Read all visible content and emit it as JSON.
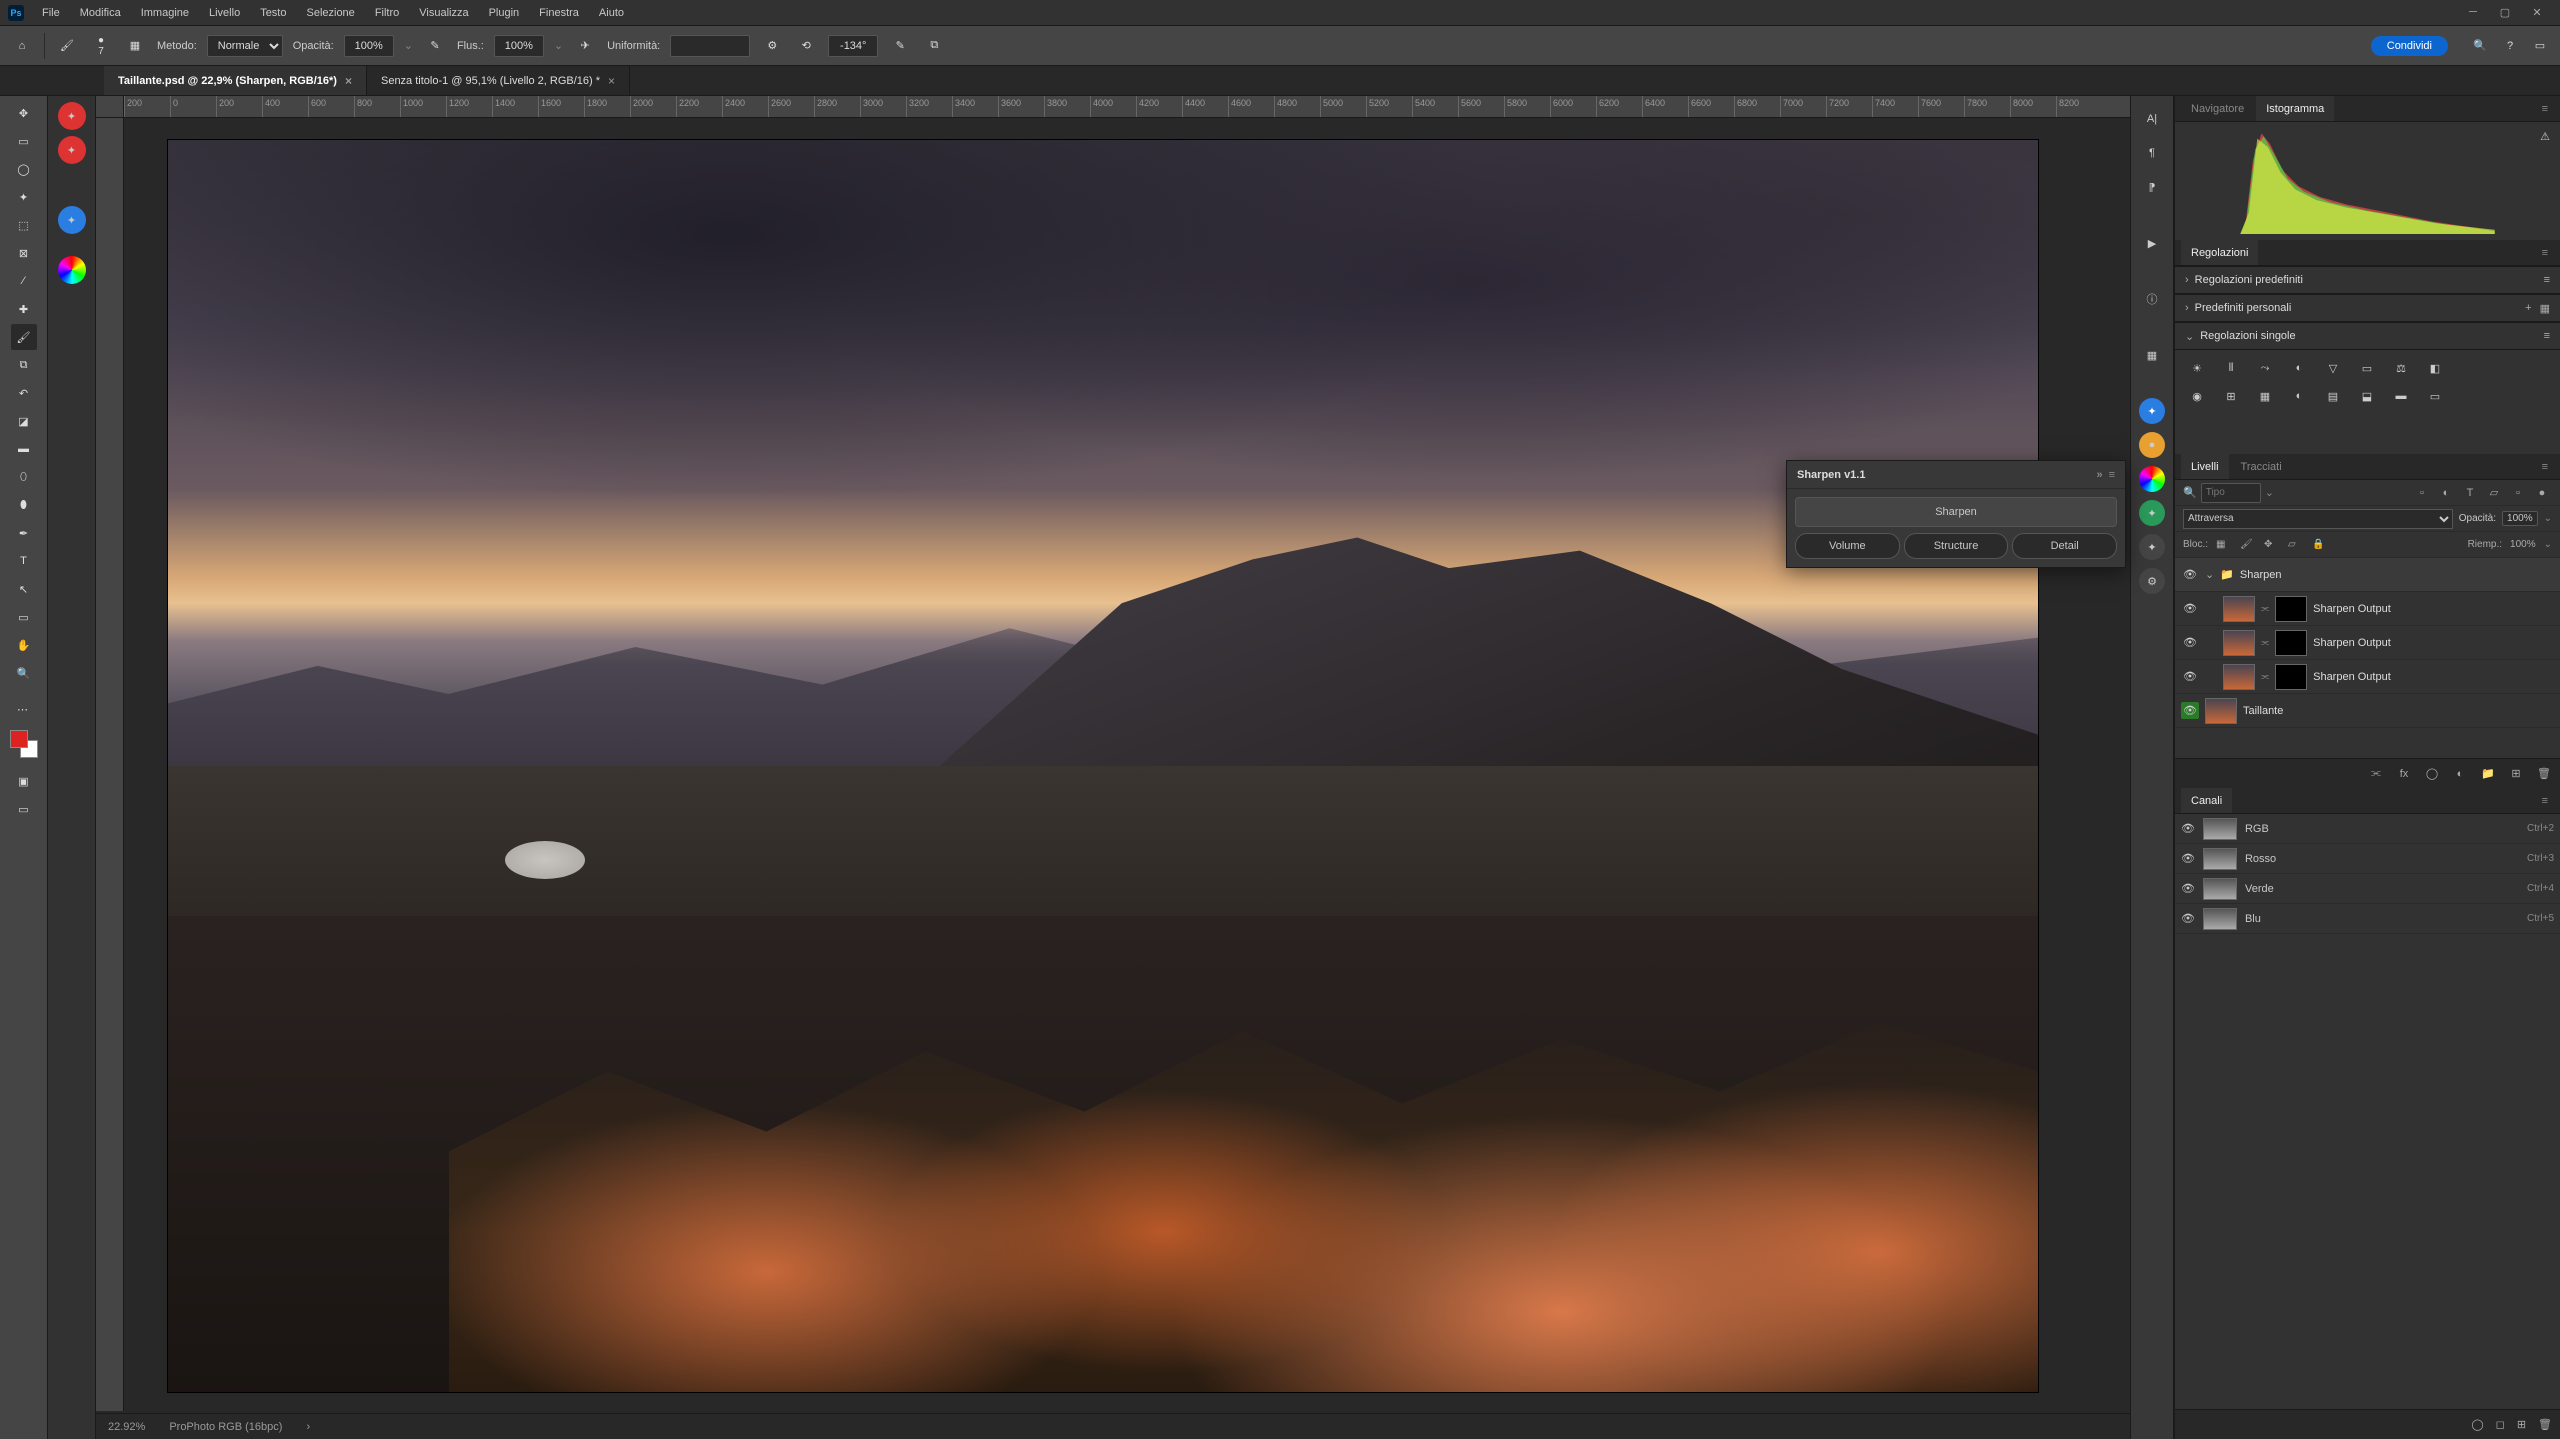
{
  "menu": [
    "File",
    "Modifica",
    "Immagine",
    "Livello",
    "Testo",
    "Selezione",
    "Filtro",
    "Visualizza",
    "Plugin",
    "Finestra",
    "Aiuto"
  ],
  "optbar": {
    "brush_size": "7",
    "method_label": "Metodo:",
    "method_value": "Normale",
    "opacity_label": "Opacità:",
    "opacity_value": "100%",
    "flow_label": "Flus.:",
    "flow_value": "100%",
    "smoothing_label": "Uniformità:",
    "angle_value": "-134°",
    "share": "Condividi"
  },
  "tabs": [
    {
      "title": "Taillante.psd @ 22,9% (Sharpen, RGB/16*)",
      "active": true
    },
    {
      "title": "Senza titolo-1 @ 95,1% (Livello 2, RGB/16) *",
      "active": false
    }
  ],
  "ruler_marks": [
    "200",
    "0",
    "200",
    "400",
    "600",
    "800",
    "1000",
    "1200",
    "1400",
    "1600",
    "1800",
    "2000",
    "2200",
    "2400",
    "2600",
    "2800",
    "3000",
    "3200",
    "3400",
    "3600",
    "3800",
    "4000",
    "4200",
    "4400",
    "4600",
    "4800",
    "5000",
    "5200",
    "5400",
    "5600",
    "5800",
    "6000",
    "6200",
    "6400",
    "6600",
    "6800",
    "7000",
    "7200",
    "7400",
    "7600",
    "7800",
    "8000",
    "8200"
  ],
  "status": {
    "zoom": "22.92%",
    "profile": "ProPhoto RGB (16bpc)"
  },
  "sharpen_panel": {
    "title": "Sharpen v1.1",
    "main": "Sharpen",
    "tabs": [
      "Volume",
      "Structure",
      "Detail"
    ]
  },
  "right_panels": {
    "nav_tab": "Navigatore",
    "histo_tab": "Istogramma",
    "adjustments": "Regolazioni",
    "preset_adj": "Regolazioni predefiniti",
    "personal_presets": "Predefiniti personali",
    "single_adj": "Regolazioni singole"
  },
  "layers": {
    "tab_layers": "Livelli",
    "tab_paths": "Tracciati",
    "filter_placeholder": "Tipo",
    "blend": "Attraversa",
    "opacity_label": "Opacità:",
    "opacity_value": "100%",
    "lock_label": "Bloc.:",
    "fill_label": "Riemp.:",
    "fill_value": "100%",
    "items": [
      {
        "type": "group",
        "name": "Sharpen",
        "selected": true
      },
      {
        "type": "layer",
        "name": "Sharpen Output",
        "indent": 1
      },
      {
        "type": "layer",
        "name": "Sharpen Output",
        "indent": 1
      },
      {
        "type": "layer",
        "name": "Sharpen Output",
        "indent": 1
      },
      {
        "type": "base",
        "name": "Taillante",
        "green_eye": true
      }
    ]
  },
  "channels": {
    "title": "Canali",
    "items": [
      {
        "name": "RGB",
        "key": "Ctrl+2"
      },
      {
        "name": "Rosso",
        "key": "Ctrl+3"
      },
      {
        "name": "Verde",
        "key": "Ctrl+4"
      },
      {
        "name": "Blu",
        "key": "Ctrl+5"
      }
    ]
  }
}
